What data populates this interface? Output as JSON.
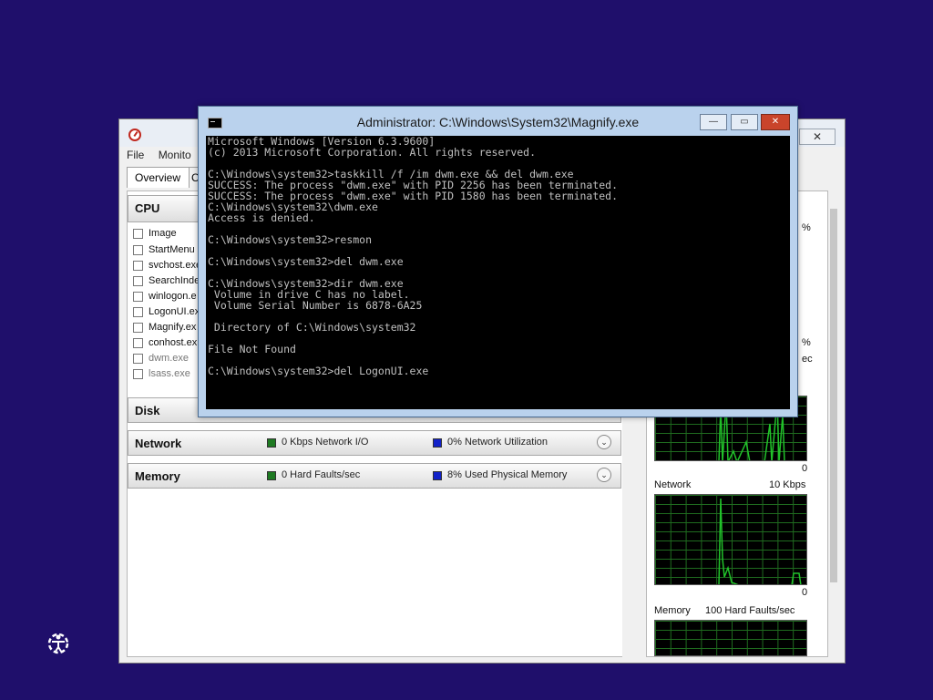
{
  "resmon": {
    "menu": [
      "File",
      "Monito"
    ],
    "tabs": [
      "Overview",
      "C"
    ],
    "sections": {
      "cpu": {
        "title": "CPU"
      },
      "disk": {
        "title": "Disk"
      },
      "network": {
        "title": "Network",
        "stat1": "0 Kbps Network I/O",
        "stat2": "0% Network Utilization"
      },
      "memory": {
        "title": "Memory",
        "stat1": "0 Hard Faults/sec",
        "stat2": "8% Used Physical Memory"
      }
    },
    "image_header": "Image",
    "processes": [
      {
        "name": "StartMenu",
        "dim": false
      },
      {
        "name": "svchost.exe",
        "dim": false
      },
      {
        "name": "SearchInde",
        "dim": false
      },
      {
        "name": "winlogon.e",
        "dim": false
      },
      {
        "name": "LogonUI.ex",
        "dim": false
      },
      {
        "name": "Magnify.ex",
        "dim": false
      },
      {
        "name": "conhost.ex",
        "dim": false
      },
      {
        "name": "dwm.exe",
        "dim": true
      },
      {
        "name": "lsass.exe",
        "dim": true
      }
    ],
    "graphs": {
      "top_pct": "%",
      "mid_pct": "%",
      "mid_sec": "ec",
      "disk_zero": "0",
      "network_label": "Network",
      "network_scale": "10 Kbps",
      "network_zero": "0",
      "memory_label": "Memory",
      "memory_scale": "100 Hard Faults/sec"
    },
    "close_glyph": "✕"
  },
  "cmd": {
    "title": "Administrator: C:\\Windows\\System32\\Magnify.exe",
    "lines": [
      "Microsoft Windows [Version 6.3.9600]",
      "(c) 2013 Microsoft Corporation. All rights reserved.",
      "",
      "C:\\Windows\\system32>taskkill /f /im dwm.exe && del dwm.exe",
      "SUCCESS: The process \"dwm.exe\" with PID 2256 has been terminated.",
      "SUCCESS: The process \"dwm.exe\" with PID 1580 has been terminated.",
      "C:\\Windows\\system32\\dwm.exe",
      "Access is denied.",
      "",
      "C:\\Windows\\system32>resmon",
      "",
      "C:\\Windows\\system32>del dwm.exe",
      "",
      "C:\\Windows\\system32>dir dwm.exe",
      " Volume in drive C has no label.",
      " Volume Serial Number is 6878-6A25",
      "",
      " Directory of C:\\Windows\\system32",
      "",
      "File Not Found",
      "",
      "C:\\Windows\\system32>del LogonUI.exe"
    ],
    "btn_min": "—",
    "btn_max": "▭",
    "btn_close": "✕"
  },
  "colors": {
    "desktop": "#1f0f6b",
    "graph_line": "#21c22a",
    "graph_grid": "#1f6b1f"
  },
  "icons": [
    "ease-of-access-icon",
    "resmon-app-icon",
    "cmd-app-icon"
  ]
}
